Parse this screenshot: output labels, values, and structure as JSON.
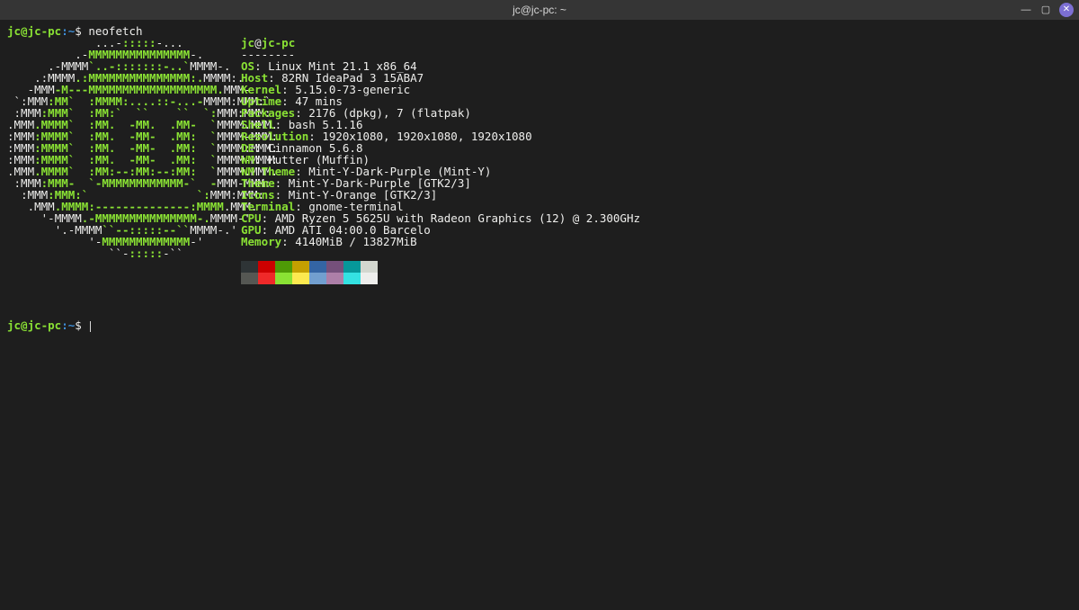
{
  "window": {
    "title": "jc@jc-pc: ~"
  },
  "prompt": {
    "user": "jc",
    "at": "@",
    "host": "jc-pc",
    "sep": ":",
    "path": "~",
    "dollar": "$ ",
    "cmd": "neofetch"
  },
  "logo": [
    {
      "pad": "             ",
      "a": "...-",
      "b": ":::::",
      "c": "-..."
    },
    {
      "pad": "          ",
      "a": ".-",
      "b": "MMMMMMMMMMMMMMM",
      "c": "-."
    },
    {
      "pad": "      ",
      "a": ".-MMMM",
      "b": "`..-:::::::-..`",
      "c": "MMMM-."
    },
    {
      "pad": "    ",
      "a": ".:MMMM",
      "b": ".:MMMMMMMMMMMMMMM:.",
      "c": "MMMM:."
    },
    {
      "pad": "   ",
      "a": "-MMM",
      "b": "-M---MMMMMMMMMMMMMMMMMMM.",
      "c": "MMM-"
    },
    {
      "pad": " ",
      "a": "`:MMM",
      "b": ":MM`  :MMMM:....::-...-",
      "c": "MMMM:",
      "d": "MMM:`"
    },
    {
      "pad": " ",
      "a": ":MMM",
      "b": ":MMM`  :MM:`  ``    ``  `:",
      "c": "MMM:",
      "d": "MMM:"
    },
    {
      "pad": "",
      "a": ".MMM",
      "b": ".MMMM`  :MM.  -MM.  .MM-  `",
      "c": "MMMM.",
      "d": "MMM."
    },
    {
      "pad": "",
      "a": ":MMM",
      "b": ":MMMM`  :MM.  -MM-  .MM:  `",
      "c": "MMMM-",
      "d": "MMM:"
    },
    {
      "pad": "",
      "a": ":MMM",
      "b": ":MMMM`  :MM.  -MM-  .MM:  `",
      "c": "MMMM:",
      "d": "MMM:"
    },
    {
      "pad": "",
      "a": ":MMM",
      "b": ":MMMM`  :MM.  -MM-  .MM:  `",
      "c": "MMMM-",
      "d": "MMM:"
    },
    {
      "pad": "",
      "a": ".MMM",
      "b": ".MMMM`  :MM:--:MM:--:MM:  `",
      "c": "MMMM.",
      "d": "MMM."
    },
    {
      "pad": " ",
      "a": ":MMM",
      "b": ":MMM-  `-MMMMMMMMMMMM-`  -",
      "c": "MMM-",
      "d": "MMM:"
    },
    {
      "pad": "  ",
      "a": ":MMM",
      "b": ":MMM:`                `:",
      "c": "MMM:",
      "d": "MMM:"
    },
    {
      "pad": "   ",
      "a": ".MMM",
      "b": ".MMMM:--------------:MMMM",
      "c": ".MMM."
    },
    {
      "pad": "     ",
      "a": "'-MMMM",
      "b": ".-MMMMMMMMMMMMMMM-.",
      "c": "MMMM-'"
    },
    {
      "pad": "       ",
      "a": "'.-MMMM",
      "b": "``--:::::--``",
      "c": "MMMM-.'"
    },
    {
      "pad": "            ",
      "a": "'-",
      "b": "MMMMMMMMMMMMM",
      "c": "-'"
    },
    {
      "pad": "               ",
      "a": "``-",
      "b": ":::::",
      "c": "-``"
    }
  ],
  "header": {
    "user": "jc",
    "at": "@",
    "host": "jc-pc",
    "dash": "--------"
  },
  "info": [
    {
      "k": "OS",
      "v": ": Linux Mint 21.1 x86_64"
    },
    {
      "k": "Host",
      "v": ": 82RN IdeaPad 3 15ABA7"
    },
    {
      "k": "Kernel",
      "v": ": 5.15.0-73-generic"
    },
    {
      "k": "Uptime",
      "v": ": 47 mins"
    },
    {
      "k": "Packages",
      "v": ": 2176 (dpkg), 7 (flatpak)"
    },
    {
      "k": "Shell",
      "v": ": bash 5.1.16"
    },
    {
      "k": "Resolution",
      "v": ": 1920x1080, 1920x1080, 1920x1080"
    },
    {
      "k": "DE",
      "v": ": Cinnamon 5.6.8"
    },
    {
      "k": "WM",
      "v": ": Mutter (Muffin)"
    },
    {
      "k": "WM Theme",
      "v": ": Mint-Y-Dark-Purple (Mint-Y)"
    },
    {
      "k": "Theme",
      "v": ": Mint-Y-Dark-Purple [GTK2/3]"
    },
    {
      "k": "Icons",
      "v": ": Mint-Y-Orange [GTK2/3]"
    },
    {
      "k": "Terminal",
      "v": ": gnome-terminal"
    },
    {
      "k": "CPU",
      "v": ": AMD Ryzen 5 5625U with Radeon Graphics (12) @ 2.300GHz"
    },
    {
      "k": "GPU",
      "v": ": AMD ATI 04:00.0 Barcelo"
    },
    {
      "k": "Memory",
      "v": ": 4140MiB / 13827MiB"
    }
  ],
  "colors_row1": [
    "#2e3436",
    "#cc0000",
    "#4e9a06",
    "#c4a000",
    "#3465a4",
    "#75507b",
    "#06989a",
    "#d3d7cf"
  ],
  "colors_row2": [
    "#555753",
    "#ef2929",
    "#8ae234",
    "#fce94f",
    "#729fcf",
    "#ad7fa8",
    "#34e2e2",
    "#eeeeec"
  ]
}
